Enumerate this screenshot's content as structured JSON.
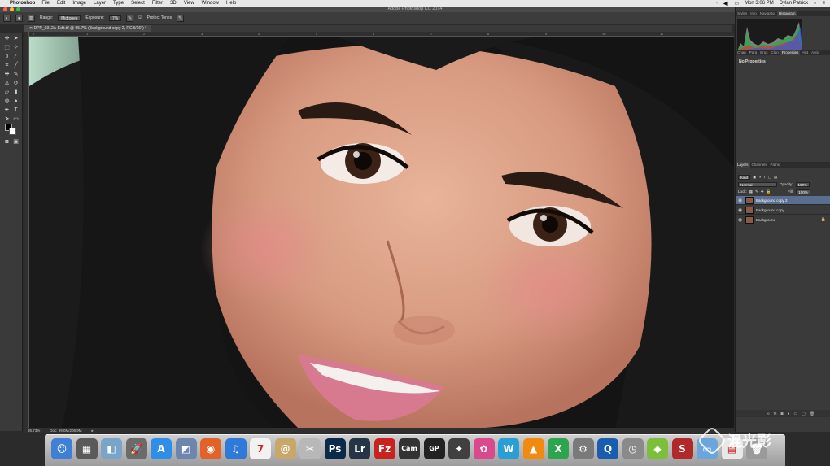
{
  "menubar": {
    "app_name": "Photoshop",
    "items": [
      "File",
      "Edit",
      "Image",
      "Layer",
      "Type",
      "Select",
      "Filter",
      "3D",
      "View",
      "Window",
      "Help"
    ],
    "clock": "Mon 3:06 PM",
    "user": "Dylan Patrick"
  },
  "window": {
    "title": "Adobe Photoshop CC 2014"
  },
  "options": {
    "range_label": "Range:",
    "range_value": "Midtones",
    "exposure_label": "Exposure:",
    "exposure_value": "7%",
    "protect_tones_label": "Protect Tones"
  },
  "document": {
    "tab_label": "DPP_0312A-Edit.tif @ 95.7% (Background copy 2, RGB/16*) *",
    "zoom": "95.73%",
    "doc_size": "Doc: 99.0M/206.9M"
  },
  "ruler": {
    "h_labels": [
      "0",
      "1",
      "2",
      "3",
      "4",
      "5",
      "6",
      "7",
      "8",
      "9",
      "10",
      "11"
    ]
  },
  "panels": {
    "top_tabs": [
      "Styles",
      "Info",
      "Navigator",
      "Histogram"
    ],
    "top_active": "Histogram",
    "mid_tabs": [
      "Chan",
      "Para",
      "Brus",
      "Clon",
      "Properties",
      "Hist",
      "Actio"
    ],
    "mid_active": "Properties",
    "properties_text": "No Properties",
    "layer_tabs": [
      "Layers",
      "Channels",
      "Paths"
    ],
    "layer_active": "Layers",
    "kind_label": "Kind",
    "blend_mode": "Normal",
    "opacity_label": "Opacity:",
    "opacity_value": "100%",
    "lock_label": "Lock:",
    "fill_label": "Fill:",
    "fill_value": "100%",
    "layers": [
      {
        "name": "Background copy 2",
        "selected": true,
        "locked": false
      },
      {
        "name": "Background copy",
        "selected": false,
        "locked": false
      },
      {
        "name": "Background",
        "selected": false,
        "locked": true
      }
    ]
  },
  "dock": {
    "icons": [
      {
        "name": "finder-icon",
        "glyph": "☺",
        "color": "#3f7fd6"
      },
      {
        "name": "calendar-app-icon",
        "glyph": "▦",
        "color": "#5a5a5a"
      },
      {
        "name": "preview-icon",
        "glyph": "◧",
        "color": "#7aa5c9"
      },
      {
        "name": "launchpad-icon",
        "glyph": "🚀",
        "color": "#6b6b6b"
      },
      {
        "name": "app-store-icon",
        "glyph": "A",
        "color": "#2f8fe8"
      },
      {
        "name": "image-capture-icon",
        "glyph": "◩",
        "color": "#6d86b0"
      },
      {
        "name": "firefox-icon",
        "glyph": "◉",
        "color": "#e2632a"
      },
      {
        "name": "itunes-icon",
        "glyph": "♫",
        "color": "#2f7ad8"
      },
      {
        "name": "calendar-icon",
        "glyph": "7",
        "color": "#f2f2f2"
      },
      {
        "name": "mail-icon",
        "glyph": "@",
        "color": "#c8a86a"
      },
      {
        "name": "scissors-icon",
        "glyph": "✂",
        "color": "#b8b8b8"
      },
      {
        "name": "photoshop-icon",
        "glyph": "Ps",
        "color": "#0b2a4a"
      },
      {
        "name": "lightroom-icon",
        "glyph": "Lr",
        "color": "#263545"
      },
      {
        "name": "filezilla-icon",
        "glyph": "Fz",
        "color": "#c8231f"
      },
      {
        "name": "camranger-icon",
        "glyph": "Cam",
        "color": "#333333"
      },
      {
        "name": "gopro-icon",
        "glyph": "GP",
        "color": "#222222"
      },
      {
        "name": "final-cut-icon",
        "glyph": "✦",
        "color": "#404040"
      },
      {
        "name": "color-icon",
        "glyph": "✿",
        "color": "#d94a8c"
      },
      {
        "name": "w-app-icon",
        "glyph": "W",
        "color": "#2a9fd6"
      },
      {
        "name": "vlc-icon",
        "glyph": "▲",
        "color": "#f08a10"
      },
      {
        "name": "x-app-icon",
        "glyph": "X",
        "color": "#2ea44f"
      },
      {
        "name": "system-prefs-icon",
        "glyph": "⚙",
        "color": "#7a7a7a"
      },
      {
        "name": "quicktime-icon",
        "glyph": "Q",
        "color": "#1a5db0"
      },
      {
        "name": "time-machine-icon",
        "glyph": "◷",
        "color": "#8a8a8a"
      },
      {
        "name": "green-app-icon",
        "glyph": "◆",
        "color": "#7bbf3a"
      },
      {
        "name": "s-app-icon",
        "glyph": "S",
        "color": "#b02a2a"
      },
      {
        "name": "folder-icon",
        "glyph": "▭",
        "color": "#6aa6dc"
      },
      {
        "name": "document-icon",
        "glyph": "▤",
        "color": "#e8e8e8"
      },
      {
        "name": "trash-icon",
        "glyph": "🗑",
        "color": "#9a9a9a"
      }
    ]
  },
  "watermark": {
    "text": "混光影"
  },
  "colors": {
    "accent": "#5a6e8f",
    "panel": "#3a3a3a",
    "menubar": "#e8e8e8"
  }
}
